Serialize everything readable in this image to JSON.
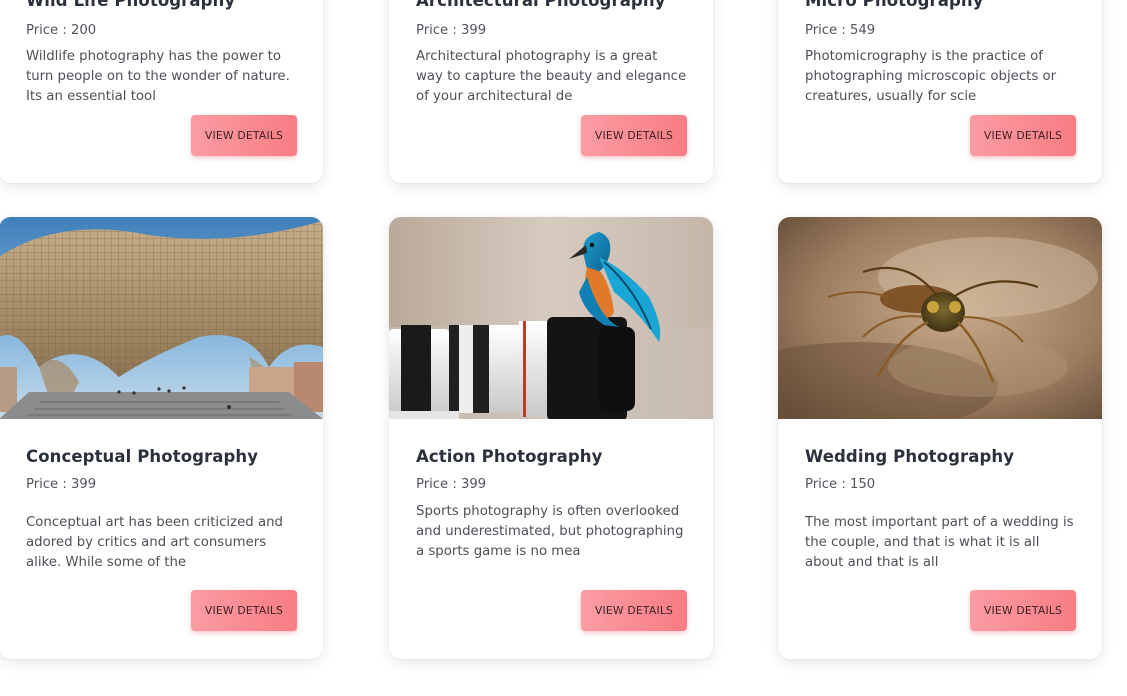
{
  "top_cards": [
    {
      "title": "Wild Life Photography",
      "price": "Price : 200",
      "description": "Wildlife photography has the power to turn people on to the wonder of nature. Its an essential tool",
      "button": "VIEW DETAILS"
    },
    {
      "title": "Architectural Photography",
      "price": "Price : 399",
      "description": "Architectural photography is a great way to capture the beauty and elegance of your architectural de",
      "button": "VIEW DETAILS"
    },
    {
      "title": "Micro Photography",
      "price": "Price : 549",
      "description": "Photomicrography is the practice of photographing microscopic objects or creatures, usually for scie",
      "button": "VIEW DETAILS"
    }
  ],
  "bottom_cards": [
    {
      "title": "Conceptual Photography",
      "price": "Price : 399",
      "description": "Conceptual art has been criticized and adored by critics and art consumers alike. While some of the",
      "button": "VIEW DETAILS",
      "image": "building-photo"
    },
    {
      "title": "Action Photography",
      "price": "Price : 399",
      "description": "Sports photography is often overlooked and underestimated, but photographing a sports game is no mea",
      "button": "VIEW DETAILS",
      "image": "kingfisher-on-camera-lens-photo"
    },
    {
      "title": "Wedding Photography",
      "price": "Price : 150",
      "description": "The most important part of a wedding is the couple, and that is what it is all about and that is all",
      "button": "VIEW DETAILS",
      "image": "insect-macro-photo"
    }
  ],
  "colors": {
    "button_gradient_start": "#fb9ca3",
    "button_gradient_end": "#f87c84",
    "title_text": "#2b313c",
    "body_text": "#4d5058"
  }
}
